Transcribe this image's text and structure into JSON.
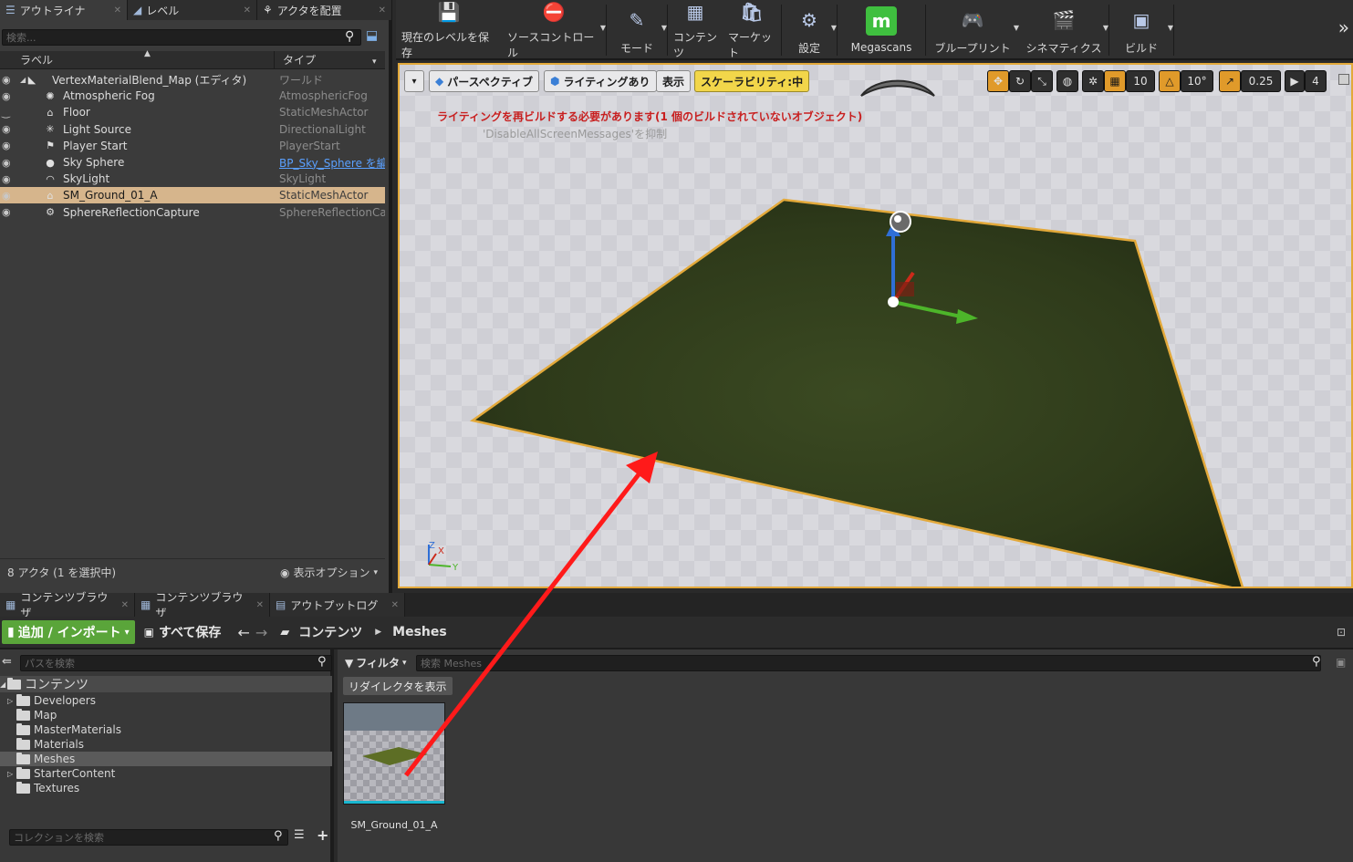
{
  "outliner": {
    "tabs": [
      {
        "label": "アウトライナ",
        "icon": "list-icon"
      },
      {
        "label": "レベル",
        "icon": "level-icon"
      },
      {
        "label": "アクタを配置",
        "icon": "place-actors-icon"
      }
    ],
    "search_placeholder": "検索...",
    "columns": {
      "label": "ラベル",
      "type": "タイプ"
    },
    "rows": [
      {
        "label": "VertexMaterialBlend_Map (エディタ)",
        "type": "ワールド",
        "icon": "world-icon",
        "selected": false,
        "indent": 0
      },
      {
        "label": "Atmospheric Fog",
        "type": "AtmosphericFog",
        "icon": "fog-icon",
        "selected": false,
        "indent": 1
      },
      {
        "label": "Floor",
        "type": "StaticMeshActor",
        "icon": "mesh-icon",
        "selected": false,
        "indent": 1
      },
      {
        "label": "Light Source",
        "type": "DirectionalLight",
        "icon": "light-icon",
        "selected": false,
        "indent": 1
      },
      {
        "label": "Player Start",
        "type": "PlayerStart",
        "icon": "flag-icon",
        "selected": false,
        "indent": 1
      },
      {
        "label": "Sky Sphere",
        "type": "BP_Sky_Sphere を編",
        "icon": "sphere-icon",
        "selected": false,
        "indent": 1,
        "type_link": true
      },
      {
        "label": "SkyLight",
        "type": "SkyLight",
        "icon": "skylight-icon",
        "selected": false,
        "indent": 1
      },
      {
        "label": "SM_Ground_01_A",
        "type": "StaticMeshActor",
        "icon": "mesh-icon",
        "selected": true,
        "indent": 1
      },
      {
        "label": "SphereReflectionCapture",
        "type": "SphereReflectionCapt",
        "icon": "reflection-icon",
        "selected": false,
        "indent": 1
      }
    ],
    "footer_count": "8 アクタ (1 を選択中)",
    "view_options": "表示オプション"
  },
  "toolbar": {
    "buttons": [
      {
        "label": "現在のレベルを保存",
        "icon": "save-icon",
        "dropdown": false
      },
      {
        "label": "ソースコントロール",
        "icon": "source-control-icon",
        "dropdown": true
      },
      {
        "label": "モード",
        "icon": "modes-icon",
        "dropdown": true
      },
      {
        "label": "コンテンツ",
        "icon": "content-icon",
        "dropdown": false
      },
      {
        "label": "マーケット",
        "icon": "marketplace-icon",
        "dropdown": false
      },
      {
        "label": "設定",
        "icon": "settings-icon",
        "dropdown": true
      },
      {
        "label": "Megascans",
        "icon": "megascans-icon",
        "dropdown": false
      },
      {
        "label": "ブループリント",
        "icon": "blueprint-icon",
        "dropdown": true
      },
      {
        "label": "シネマティクス",
        "icon": "cinematics-icon",
        "dropdown": true
      },
      {
        "label": "ビルド",
        "icon": "build-icon",
        "dropdown": true
      }
    ]
  },
  "viewport": {
    "buttons": {
      "perspective": "パースペクティブ",
      "lighting": "ライティングあり",
      "show": "表示",
      "scalability": "スケーラビリティ:中"
    },
    "grid_snap": "10",
    "rotation_snap": "10°",
    "scale_snap": "0.25",
    "camera_speed": "4",
    "warning": "ライティングを再ビルドする必要があります(1 個のビルドされていないオブジェクト)",
    "suppress_msg": "'DisableAllScreenMessages'を抑制",
    "axis_labels": {
      "x": "X",
      "y": "Y",
      "z": "Z"
    }
  },
  "bottom_tabs": [
    {
      "label": "コンテンツブラウザ",
      "icon": "content-browser-icon"
    },
    {
      "label": "コンテンツブラウザ",
      "icon": "content-browser-icon"
    },
    {
      "label": "アウトプットログ",
      "icon": "output-log-icon"
    }
  ],
  "content_browser": {
    "add_import": "追加 / インポート",
    "save_all": "すべて保存",
    "breadcrumb": [
      "コンテンツ",
      "Meshes"
    ],
    "path_search_placeholder": "パスを検索",
    "tree_root": "コンテンツ",
    "folders": [
      {
        "name": "Developers",
        "expandable": true,
        "selected": false
      },
      {
        "name": "Map",
        "expandable": false,
        "selected": false
      },
      {
        "name": "MasterMaterials",
        "expandable": false,
        "selected": false
      },
      {
        "name": "Materials",
        "expandable": false,
        "selected": false
      },
      {
        "name": "Meshes",
        "expandable": false,
        "selected": true
      },
      {
        "name": "StarterContent",
        "expandable": true,
        "selected": false
      },
      {
        "name": "Textures",
        "expandable": false,
        "selected": false
      }
    ],
    "collection_search_placeholder": "コレクションを検索",
    "filter_label": "フィルタ",
    "asset_search_placeholder": "検索 Meshes",
    "show_redirectors": "リダイレクタを表示",
    "assets": [
      {
        "name": "SM_Ground_01_A"
      }
    ]
  },
  "colors": {
    "selection": "#d6b58c",
    "accent_orange": "#e3a93a",
    "warning_red": "#c81f1f",
    "add_green": "#5aa53a",
    "annotation_arrow": "#ff1a1a"
  }
}
